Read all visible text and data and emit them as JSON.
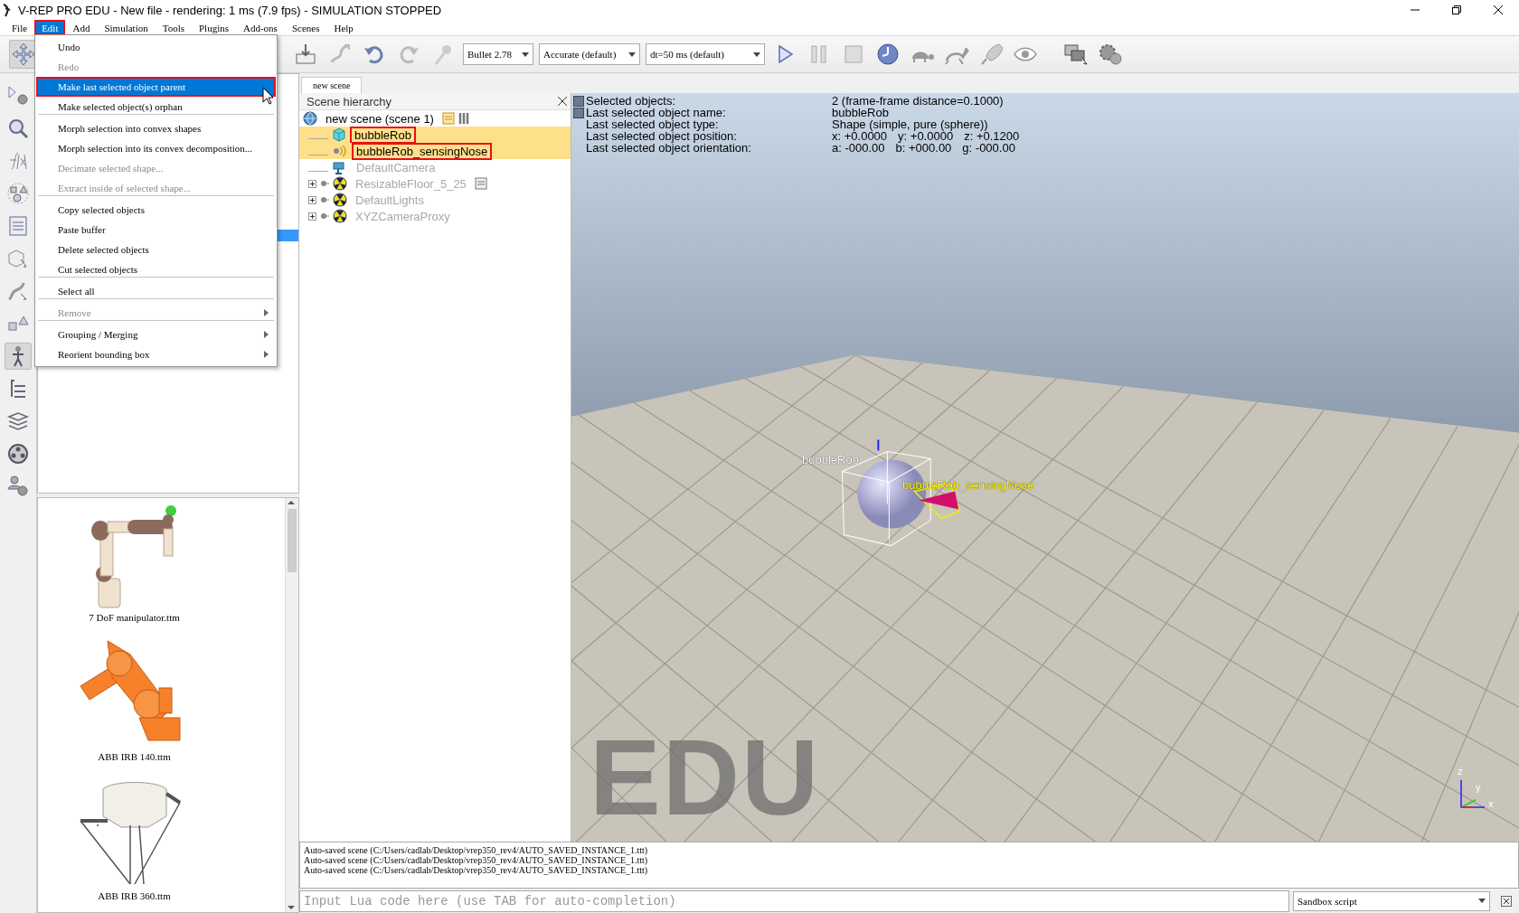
{
  "window": {
    "title": "V-REP PRO EDU - New file - rendering: 1 ms (7.9 fps) - SIMULATION STOPPED"
  },
  "menu_bar": [
    {
      "label": "File",
      "selected": false,
      "highlighted": false
    },
    {
      "label": "Edit",
      "selected": true,
      "highlighted": true
    },
    {
      "label": "Add",
      "selected": false,
      "highlighted": false
    },
    {
      "label": "Simulation",
      "selected": false,
      "highlighted": false
    },
    {
      "label": "Tools",
      "selected": false,
      "highlighted": false
    },
    {
      "label": "Plugins",
      "selected": false,
      "highlighted": false
    },
    {
      "label": "Add-ons",
      "selected": false,
      "highlighted": false
    },
    {
      "label": "Scenes",
      "selected": false,
      "highlighted": false
    },
    {
      "label": "Help",
      "selected": false,
      "highlighted": false
    }
  ],
  "edit_menu": [
    {
      "label": "Undo",
      "disabled": false,
      "selected": false,
      "highlighted": false,
      "submenu": false,
      "separator_after": false
    },
    {
      "label": "Redo",
      "disabled": true,
      "selected": false,
      "highlighted": false,
      "submenu": false,
      "separator_after": false
    },
    {
      "label": "Make last selected object parent",
      "disabled": false,
      "selected": true,
      "highlighted": true,
      "submenu": false,
      "separator_after": false
    },
    {
      "label": "Make selected object(s) orphan",
      "disabled": false,
      "selected": false,
      "highlighted": false,
      "submenu": false,
      "separator_after": true
    },
    {
      "label": "Morph selection into convex shapes",
      "disabled": false,
      "selected": false,
      "highlighted": false,
      "submenu": false,
      "separator_after": false
    },
    {
      "label": "Morph selection into its convex decomposition...",
      "disabled": false,
      "selected": false,
      "highlighted": false,
      "submenu": false,
      "separator_after": false
    },
    {
      "label": "Decimate selected shape...",
      "disabled": true,
      "selected": false,
      "highlighted": false,
      "submenu": false,
      "separator_after": false
    },
    {
      "label": "Extract inside of selected shape...",
      "disabled": true,
      "selected": false,
      "highlighted": false,
      "submenu": false,
      "separator_after": true
    },
    {
      "label": "Copy selected objects",
      "disabled": false,
      "selected": false,
      "highlighted": false,
      "submenu": false,
      "separator_after": false
    },
    {
      "label": "Paste buffer",
      "disabled": false,
      "selected": false,
      "highlighted": false,
      "submenu": false,
      "separator_after": false
    },
    {
      "label": "Delete selected objects",
      "disabled": false,
      "selected": false,
      "highlighted": false,
      "submenu": false,
      "separator_after": false
    },
    {
      "label": "Cut selected objects",
      "disabled": false,
      "selected": false,
      "highlighted": false,
      "submenu": false,
      "separator_after": true
    },
    {
      "label": "Select all",
      "disabled": false,
      "selected": false,
      "highlighted": false,
      "submenu": false,
      "separator_after": true
    },
    {
      "label": "Remove",
      "disabled": true,
      "selected": false,
      "highlighted": false,
      "submenu": true,
      "separator_after": true
    },
    {
      "label": "Grouping / Merging",
      "disabled": false,
      "selected": false,
      "highlighted": false,
      "submenu": true,
      "separator_after": false
    },
    {
      "label": "Reorient bounding box",
      "disabled": false,
      "selected": false,
      "highlighted": false,
      "submenu": true,
      "separator_after": false
    }
  ],
  "toolbar": {
    "dropdowns": [
      {
        "value": "Bullet 2.78"
      },
      {
        "value": "Accurate (default)"
      },
      {
        "value": "dt=50 ms (default)"
      }
    ]
  },
  "scene_tabs": [
    {
      "label": "new scene",
      "selected": true
    }
  ],
  "scene_hierarchy": {
    "title": "Scene hierarchy",
    "root": {
      "label": "new scene (scene 1)",
      "children": [
        {
          "label": "bubbleRob",
          "kind": "shape",
          "selected": true,
          "last_selected": true,
          "highlighted": true,
          "dimmed": false,
          "expandable": false
        },
        {
          "label": "bubbleRob_sensingNose",
          "kind": "sensor",
          "selected": true,
          "last_selected": false,
          "highlighted": true,
          "dimmed": false,
          "expandable": false
        },
        {
          "label": "DefaultCamera",
          "kind": "camera",
          "selected": false,
          "last_selected": false,
          "highlighted": false,
          "dimmed": true,
          "expandable": false
        },
        {
          "label": "ResizableFloor_5_25",
          "kind": "scripted_model",
          "selected": false,
          "last_selected": false,
          "highlighted": false,
          "dimmed": true,
          "expandable": true
        },
        {
          "label": "DefaultLights",
          "kind": "model",
          "selected": false,
          "last_selected": false,
          "highlighted": false,
          "dimmed": true,
          "expandable": true
        },
        {
          "label": "XYZCameraProxy",
          "kind": "model",
          "selected": false,
          "last_selected": false,
          "highlighted": false,
          "dimmed": true,
          "expandable": true
        }
      ]
    }
  },
  "object_info": [
    {
      "label": "Selected objects:",
      "values": [
        "2 (frame-frame distance=0.1000)"
      ]
    },
    {
      "label": "Last selected object name:",
      "values": [
        "bubbleRob"
      ]
    },
    {
      "label": "Last selected object type:",
      "values": [
        "Shape (simple, pure (sphere))"
      ]
    },
    {
      "label": "Last selected object position:",
      "values": [
        "x: +0.0000",
        "y: +0.0000",
        "z: +0.1200"
      ]
    },
    {
      "label": "Last selected object orientation:",
      "values": [
        "a: -000.00",
        "b: +000.00",
        "g: -000.00"
      ]
    }
  ],
  "viewport": {
    "object_labels": [
      {
        "text": "bubbleRob",
        "color": "#ffffff"
      },
      {
        "text": "bubbleRob_sensingNose",
        "color": "#ffff00"
      }
    ],
    "watermark": "EDU",
    "axis_labels": [
      "z",
      "y",
      "x"
    ]
  },
  "model_browser": {
    "models": [
      {
        "name": "7 DoF manipulator.ttm",
        "kind": "manipulator"
      },
      {
        "name": "ABB IRB 140.ttm",
        "kind": "industrial"
      },
      {
        "name": "ABB IRB 360.ttm",
        "kind": "delta"
      }
    ]
  },
  "console": {
    "lines": [
      "Auto-saved scene (C:/Users/cadlab/Desktop/vrep350_rev4/AUTO_SAVED_INSTANCE_1.ttt)",
      "Auto-saved scene (C:/Users/cadlab/Desktop/vrep350_rev4/AUTO_SAVED_INSTANCE_1.ttt)",
      "Auto-saved scene (C:/Users/cadlab/Desktop/vrep350_rev4/AUTO_SAVED_INSTANCE_1.ttt)"
    ]
  },
  "lua_input": {
    "placeholder": "Input Lua code here (use TAB for auto-completion)"
  },
  "script_selector": {
    "value": "Sandbox script"
  }
}
